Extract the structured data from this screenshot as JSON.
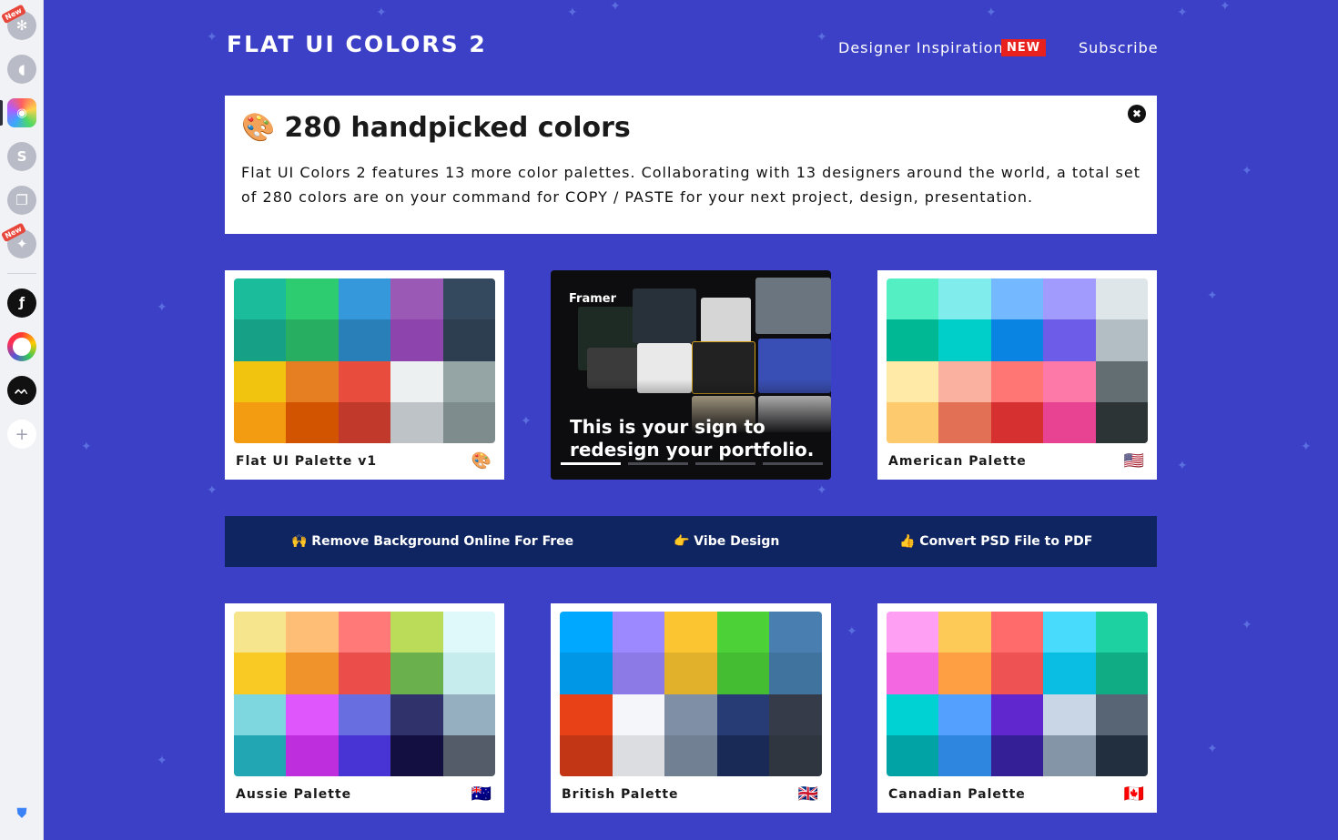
{
  "sidebar": {
    "new_badge": "New",
    "s_letter": "S"
  },
  "header": {
    "logo": "FLAT UI COLORS 2",
    "designer_inspiration": "Designer Inspiration",
    "new_badge": "NEW",
    "subscribe": "Subscribe"
  },
  "intro": {
    "emoji": "🎨",
    "title": "280 handpicked colors",
    "text": "Flat UI Colors 2 features 13 more color palettes. Collaborating with 13 designers around the world, a total set of 280 colors are on your command for COPY / PASTE for your next project, design, presentation.",
    "close_symbol": "✖"
  },
  "ad": {
    "brand": "Framer",
    "line1": "This is your sign to",
    "line2": "redesign your portfolio."
  },
  "links": {
    "remove_bg": "🙌 Remove Background Online For Free",
    "vibe": "👉 Vibe Design",
    "psd": "👍 Convert PSD File to PDF"
  },
  "palettes": [
    {
      "name": "Flat UI Palette v1",
      "flag": "🎨",
      "colors": [
        "#1abc9c",
        "#2ecc71",
        "#3498db",
        "#9b59b6",
        "#34495e",
        "#16a085",
        "#27ae60",
        "#2980b9",
        "#8e44ad",
        "#2c3e50",
        "#f1c40f",
        "#e67e22",
        "#e74c3c",
        "#ecf0f1",
        "#95a5a6",
        "#f39c12",
        "#d35400",
        "#c0392b",
        "#bdc3c7",
        "#7f8c8d"
      ]
    },
    {
      "name": "American Palette",
      "flag": "🇺🇸",
      "colors": [
        "#55efc4",
        "#81ecec",
        "#74b9ff",
        "#a29bfe",
        "#dfe6e9",
        "#00b894",
        "#00cec9",
        "#0984e3",
        "#6c5ce7",
        "#b2bec3",
        "#ffeaa7",
        "#fab1a0",
        "#ff7675",
        "#fd79a8",
        "#636e72",
        "#fdcb6e",
        "#e17055",
        "#d63031",
        "#e84393",
        "#2d3436"
      ]
    },
    {
      "name": "Aussie Palette",
      "flag": "🇦🇺",
      "colors": [
        "#f6e58d",
        "#ffbe76",
        "#ff7979",
        "#badc58",
        "#dff9fb",
        "#f9ca24",
        "#f0932b",
        "#eb4d4b",
        "#6ab04c",
        "#c7ecee",
        "#7ed6df",
        "#e056fd",
        "#686de0",
        "#30336b",
        "#95afc0",
        "#22a6b3",
        "#be2edd",
        "#4834d4",
        "#130f40",
        "#535c68"
      ]
    },
    {
      "name": "British Palette",
      "flag": "🇬🇧",
      "colors": [
        "#00a8ff",
        "#9c88ff",
        "#fbc531",
        "#4cd137",
        "#487eb0",
        "#0097e6",
        "#8c7ae6",
        "#e1b12c",
        "#44bd32",
        "#40739e",
        "#e84118",
        "#f5f6fa",
        "#7f8fa6",
        "#273c75",
        "#353b48",
        "#c23616",
        "#dcdde1",
        "#718093",
        "#192a56",
        "#2f3640"
      ]
    },
    {
      "name": "Canadian Palette",
      "flag": "🇨🇦",
      "colors": [
        "#ff9ff3",
        "#feca57",
        "#ff6b6b",
        "#48dbfb",
        "#1dd1a1",
        "#f368e0",
        "#ff9f43",
        "#ee5253",
        "#0abde3",
        "#10ac84",
        "#00d2d3",
        "#54a0ff",
        "#5f27cd",
        "#c8d6e5",
        "#576574",
        "#01a3a4",
        "#2e86de",
        "#341f97",
        "#8395a7",
        "#222f3e"
      ]
    }
  ]
}
